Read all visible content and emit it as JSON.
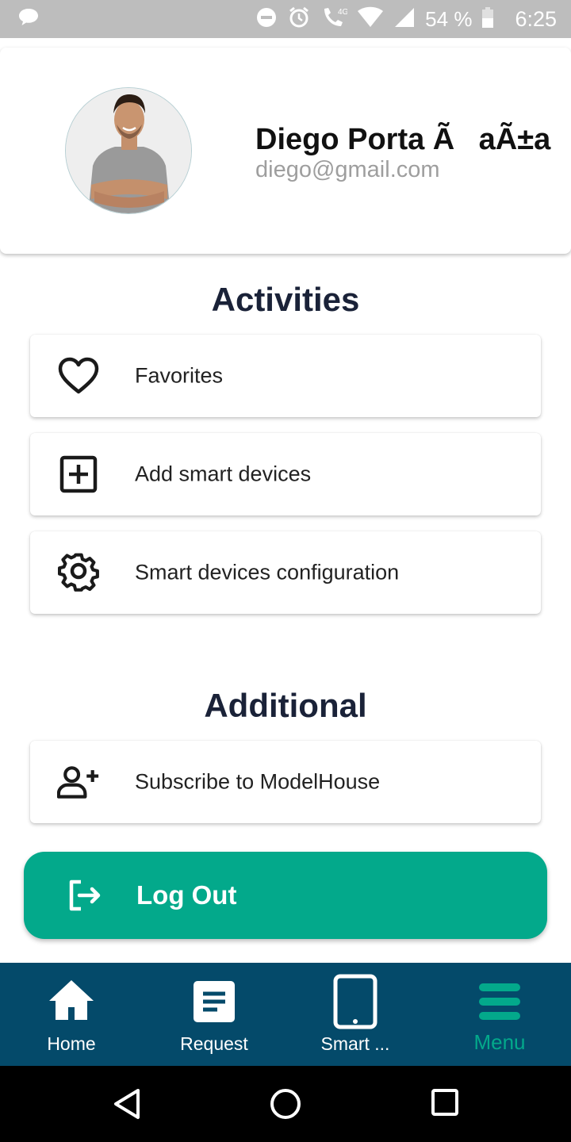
{
  "status_bar": {
    "battery_percent": "54 %",
    "time": "6:25",
    "network_label": "4G",
    "icons": [
      "chat-bubble-icon",
      "do-not-disturb-icon",
      "alarm-icon",
      "call-4g-icon",
      "wifi-icon",
      "signal-icon",
      "battery-icon"
    ]
  },
  "profile": {
    "name": "Diego Porta ÃaÃ±a",
    "email": "diego@gmail.com"
  },
  "activities": {
    "title": "Activities",
    "items": [
      {
        "label": "Favorites",
        "icon": "heart-icon"
      },
      {
        "label": "Add smart devices",
        "icon": "plus-square-icon"
      },
      {
        "label": "Smart devices configuration",
        "icon": "gear-icon"
      }
    ]
  },
  "additional": {
    "title": "Additional",
    "items": [
      {
        "label": "Subscribe to ModelHouse",
        "icon": "add-user-icon"
      }
    ]
  },
  "logout": {
    "label": "Log Out",
    "icon": "logout-icon",
    "color": "#03a98b"
  },
  "bottom_nav": {
    "background": "#044a6a",
    "items": [
      {
        "label": "Home",
        "icon": "home-icon",
        "active": false
      },
      {
        "label": "Request",
        "icon": "document-icon",
        "active": false
      },
      {
        "label": "Smart ...",
        "icon": "tablet-icon",
        "active": false
      },
      {
        "label": "Menu",
        "icon": "menu-icon",
        "active": true
      }
    ]
  },
  "system_nav": {
    "buttons": [
      "back-icon",
      "home-circle-icon",
      "recents-icon"
    ]
  }
}
